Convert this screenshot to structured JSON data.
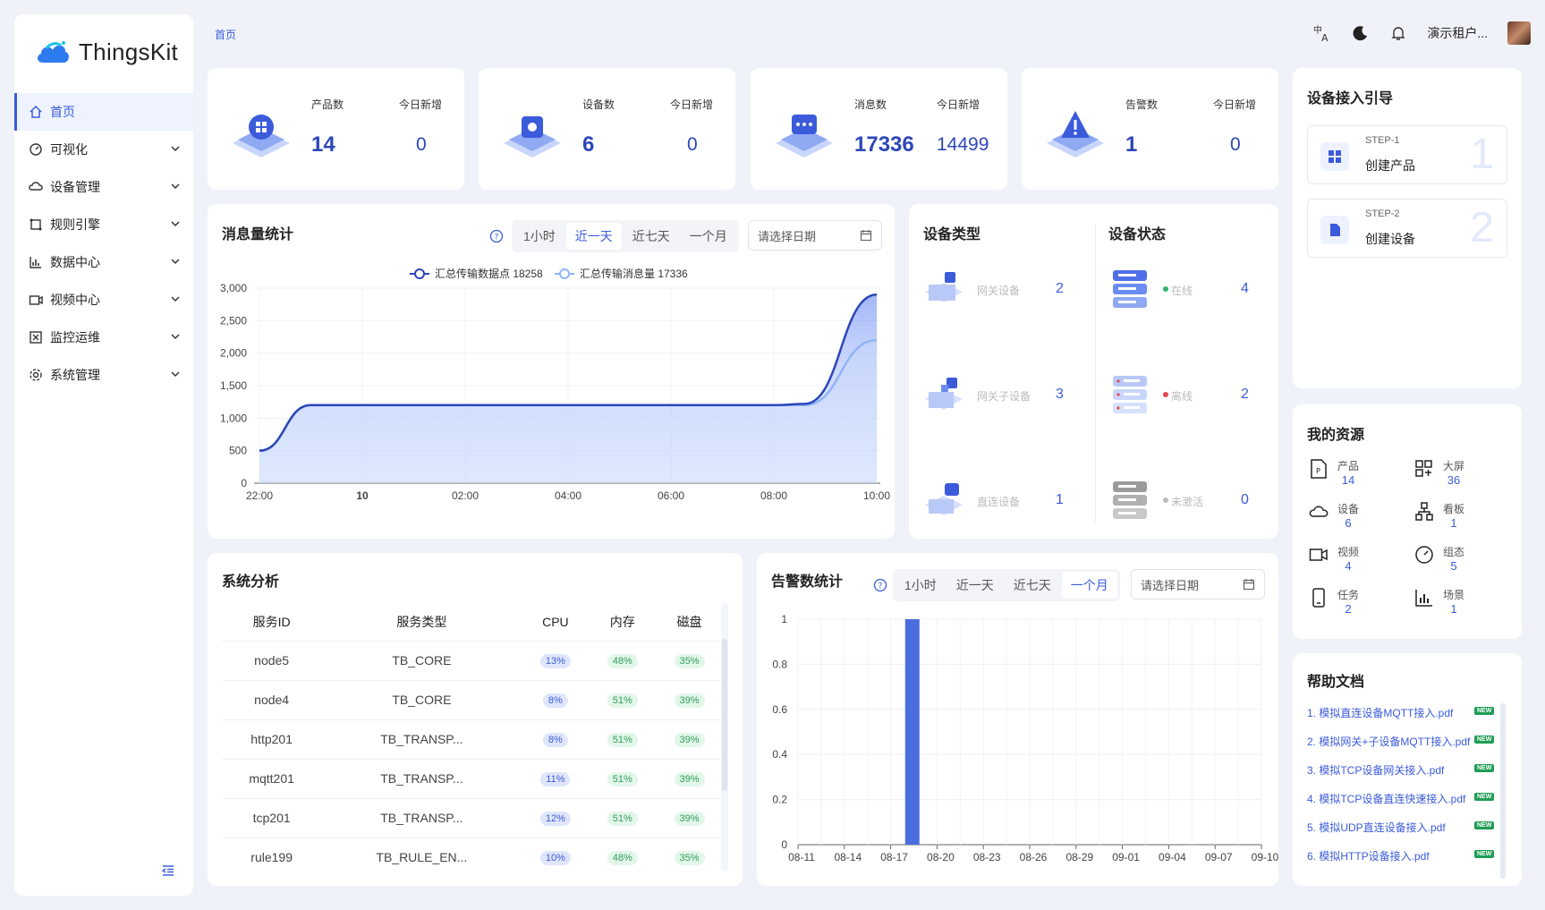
{
  "app": {
    "logo_text": "ThingsKit"
  },
  "sidebar": {
    "items": [
      {
        "label": "首页",
        "icon": "home-icon",
        "active": true,
        "expandable": false
      },
      {
        "label": "可视化",
        "icon": "dashboard-icon",
        "expandable": true
      },
      {
        "label": "设备管理",
        "icon": "cloud-device-icon",
        "expandable": true
      },
      {
        "label": "规则引擎",
        "icon": "rule-icon",
        "expandable": true
      },
      {
        "label": "数据中心",
        "icon": "bar-chart-icon",
        "expandable": true
      },
      {
        "label": "视频中心",
        "icon": "video-icon",
        "expandable": true
      },
      {
        "label": "监控运维",
        "icon": "monitor-icon",
        "expandable": true
      },
      {
        "label": "系统管理",
        "icon": "gear-icon",
        "expandable": true
      }
    ]
  },
  "header": {
    "breadcrumb": "首页",
    "user": "演示租户..."
  },
  "stats": [
    {
      "label": "产品数",
      "value": "14",
      "today_label": "今日新增",
      "today": "0",
      "icon": "product-icon"
    },
    {
      "label": "设备数",
      "value": "6",
      "today_label": "今日新增",
      "today": "0",
      "icon": "chip-icon"
    },
    {
      "label": "消息数",
      "value": "17336",
      "today_label": "今日新增",
      "today": "14499",
      "icon": "message-icon"
    },
    {
      "label": "告警数",
      "value": "1",
      "today_label": "今日新增",
      "today": "0",
      "icon": "alert-icon"
    }
  ],
  "msg_chart": {
    "title": "消息量统计",
    "tabs": [
      "1小时",
      "近一天",
      "近七天",
      "一个月"
    ],
    "active_tab": 1,
    "date_placeholder": "请选择日期",
    "legend": [
      "汇总传输数据点 18258",
      "汇总传输消息量 17336"
    ]
  },
  "chart_data": [
    {
      "type": "area",
      "x": [
        "22:00",
        "10",
        "02:00",
        "04:00",
        "06:00",
        "08:00",
        "10:00"
      ],
      "y_ticks": [
        "3,000",
        "2,500",
        "2,000",
        "1,500",
        "1,000",
        "500",
        "0"
      ],
      "ylim": [
        0,
        3000
      ],
      "series": [
        {
          "name": "汇总传输数据点 18258",
          "points": [
            [
              0,
              500
            ],
            [
              0.5,
              1200
            ],
            [
              1,
              1200
            ],
            [
              2,
              1200
            ],
            [
              3,
              1200
            ],
            [
              4,
              1200
            ],
            [
              5,
              1200
            ],
            [
              5.3,
              1220
            ],
            [
              6,
              2900
            ]
          ]
        },
        {
          "name": "汇总传输消息量 17336",
          "points": [
            [
              0,
              500
            ],
            [
              0.5,
              1200
            ],
            [
              1,
              1200
            ],
            [
              2,
              1200
            ],
            [
              3,
              1200
            ],
            [
              4,
              1200
            ],
            [
              5,
              1200
            ],
            [
              5.3,
              1200
            ],
            [
              6,
              2200
            ]
          ]
        }
      ],
      "grid": true
    },
    {
      "type": "bar",
      "categories": [
        "08-11",
        "08-14",
        "08-17",
        "08-20",
        "08-23",
        "08-26",
        "08-29",
        "09-01",
        "09-04",
        "09-07",
        "09-10"
      ],
      "y_ticks": [
        "1",
        "0.8",
        "0.6",
        "0.4",
        "0.2",
        "0"
      ],
      "ylim": [
        0,
        1
      ],
      "series": [
        {
          "values": [
            {
              "x": 7.4,
              "y": 1
            }
          ]
        }
      ],
      "grid": true
    }
  ],
  "device_type": {
    "title": "设备类型",
    "items": [
      {
        "label": "网关设备",
        "value": "2",
        "icon": "gateway-icon"
      },
      {
        "label": "网关子设备",
        "value": "3",
        "icon": "sub-device-icon"
      },
      {
        "label": "直连设备",
        "value": "1",
        "icon": "direct-device-icon"
      }
    ]
  },
  "device_status": {
    "title": "设备状态",
    "items": [
      {
        "label": "在线",
        "value": "4",
        "color": "#2fb36c",
        "icon": "server-online-icon"
      },
      {
        "label": "离线",
        "value": "2",
        "color": "#e5484d",
        "icon": "server-offline-icon"
      },
      {
        "label": "未激活",
        "value": "0",
        "color": "#bbbbbb",
        "icon": "server-inactive-icon"
      }
    ]
  },
  "sys": {
    "title": "系统分析",
    "columns": [
      "服务ID",
      "服务类型",
      "CPU",
      "内存",
      "磁盘"
    ],
    "rows": [
      [
        "node5",
        "TB_CORE",
        "13%",
        "48%",
        "35%"
      ],
      [
        "node4",
        "TB_CORE",
        "8%",
        "51%",
        "39%"
      ],
      [
        "http201",
        "TB_TRANSP...",
        "8%",
        "51%",
        "39%"
      ],
      [
        "mqtt201",
        "TB_TRANSP...",
        "11%",
        "51%",
        "39%"
      ],
      [
        "tcp201",
        "TB_TRANSP...",
        "12%",
        "51%",
        "39%"
      ],
      [
        "rule199",
        "TB_RULE_EN...",
        "10%",
        "48%",
        "35%"
      ]
    ]
  },
  "alarm_chart": {
    "title": "告警数统计",
    "tabs": [
      "1小时",
      "近一天",
      "近七天",
      "一个月"
    ],
    "active_tab": 3,
    "date_placeholder": "请选择日期"
  },
  "guide": {
    "title": "设备接入引导",
    "steps": [
      {
        "step": "STEP-1",
        "label": "创建产品",
        "num": "1",
        "icon": "grid-icon"
      },
      {
        "step": "STEP-2",
        "label": "创建设备",
        "num": "2",
        "icon": "device-doc-icon"
      }
    ]
  },
  "resources": {
    "title": "我的资源",
    "items": [
      {
        "label": "产品",
        "value": "14",
        "icon": "product-file-icon"
      },
      {
        "label": "大屏",
        "value": "36",
        "icon": "screen-grid-icon"
      },
      {
        "label": "设备",
        "value": "6",
        "icon": "cloud-device-icon"
      },
      {
        "label": "看板",
        "value": "1",
        "icon": "org-chart-icon"
      },
      {
        "label": "视频",
        "value": "4",
        "icon": "video-icon"
      },
      {
        "label": "组态",
        "value": "5",
        "icon": "gauge-icon"
      },
      {
        "label": "任务",
        "value": "2",
        "icon": "phone-icon"
      },
      {
        "label": "场景",
        "value": "1",
        "icon": "bar-chart-icon"
      }
    ]
  },
  "docs": {
    "title": "帮助文档",
    "badge": "NEW",
    "items": [
      "1. 模拟直连设备MQTT接入.pdf",
      "2. 模拟网关+子设备MQTT接入.pdf",
      "3. 模拟TCP设备网关接入.pdf",
      "4. 模拟TCP设备直连快速接入.pdf",
      "5. 模拟UDP直连设备接入.pdf",
      "6. 模拟HTTP设备接入.pdf"
    ]
  }
}
